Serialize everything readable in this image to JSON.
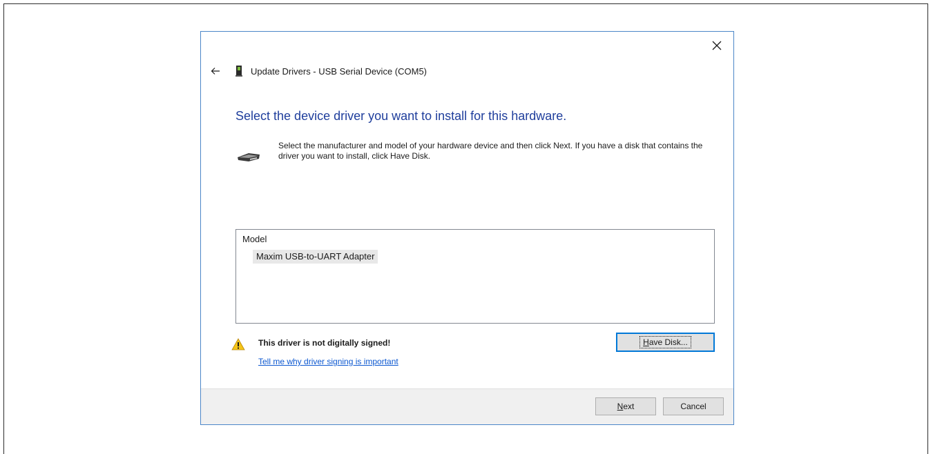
{
  "dialog": {
    "title": "Update Drivers - USB Serial Device (COM5)",
    "heading": "Select the device driver you want to install for this hardware.",
    "instructions": "Select the manufacturer and model of your hardware device and then click Next. If you have a disk that contains the driver you want to install, click Have Disk.",
    "model_list": {
      "header": "Model",
      "items": [
        "Maxim USB-to-UART Adapter"
      ]
    },
    "warning": {
      "icon": "warning-icon",
      "text": "This driver is not digitally signed!",
      "link": "Tell me why driver signing is important"
    },
    "buttons": {
      "have_disk": {
        "accel": "H",
        "rest": "ave Disk..."
      },
      "next": {
        "accel": "N",
        "rest": "ext"
      },
      "cancel": "Cancel"
    },
    "icons": {
      "close": "close-icon",
      "back": "back-arrow-icon",
      "device": "usb-device-icon",
      "hardware": "hardware-icon"
    },
    "colors": {
      "heading": "#1f3e9c",
      "link": "#0b57d0",
      "focus_border": "#0078d7",
      "footer_bg": "#f0f0f0"
    }
  }
}
